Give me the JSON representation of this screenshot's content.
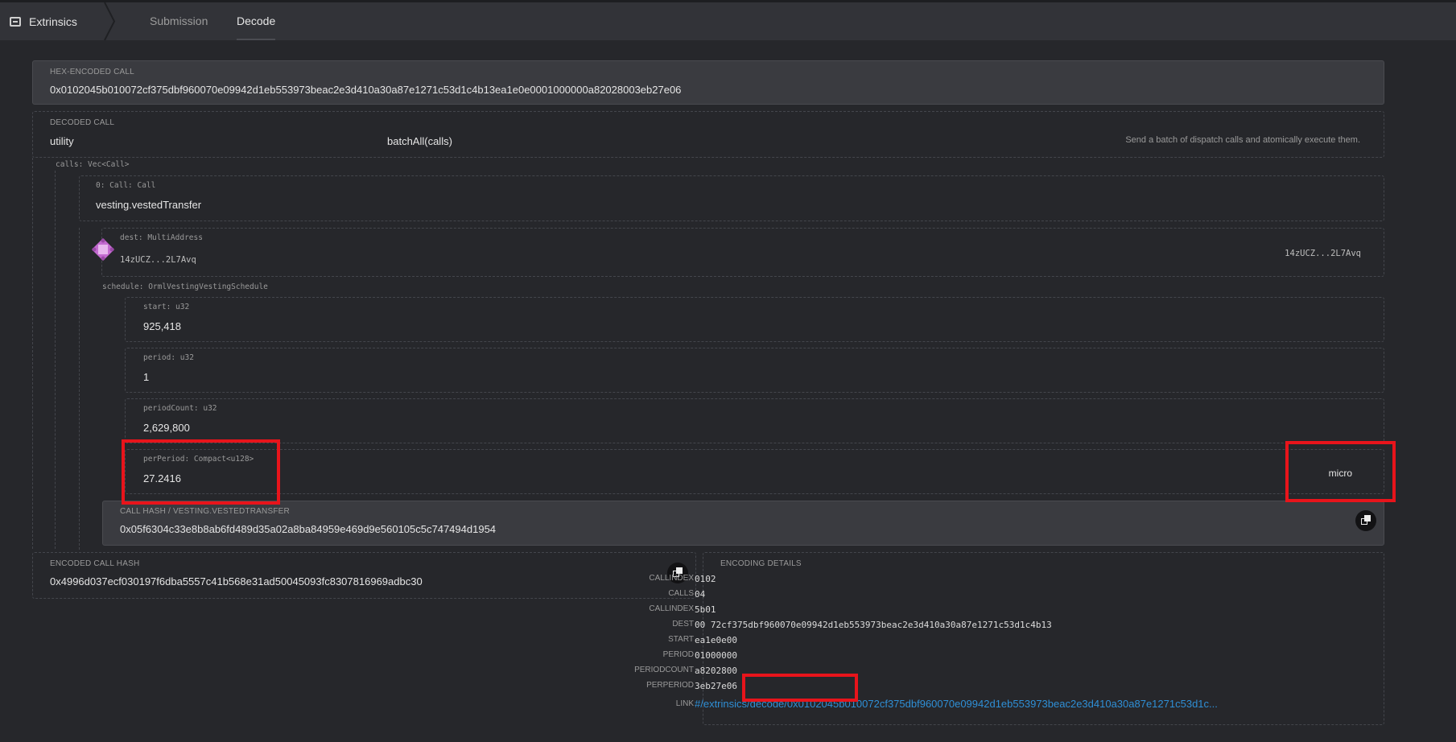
{
  "header": {
    "app_title": "Extrinsics",
    "tabs": [
      {
        "label": "Submission"
      },
      {
        "label": "Decode"
      }
    ]
  },
  "hex_call": {
    "label": "HEX-ENCODED CALL",
    "value": "0x0102045b010072cf375dbf960070e09942d1eb553973beac2e3d410a30a87e1271c53d1c4b13ea1e0e0001000000a82028003eb27e06"
  },
  "decoded_call": {
    "label": "DECODED CALL",
    "section": "utility",
    "method": "batchAll(calls)",
    "description": "Send a batch of dispatch calls and atomically execute them."
  },
  "calls": {
    "label": "calls: Vec<Call>",
    "item0_label": "0: Call: Call",
    "item0_value": "vesting.vestedTransfer",
    "dest_label": "dest: MultiAddress",
    "dest_value": "14zUCZ...2L7Avq",
    "dest_right": "14zUCZ...2L7Avq",
    "schedule_label": "schedule: OrmlVestingVestingSchedule",
    "start_label": "start: u32",
    "start_value": "925,418",
    "period_label": "period: u32",
    "period_value": "1",
    "periodcount_label": "periodCount: u32",
    "periodcount_value": "2,629,800",
    "perperiod_label": "perPeriod: Compact<u128>",
    "perperiod_value": "27.2416",
    "perperiod_unit": "micro"
  },
  "call_hash": {
    "label": "CALL HASH / VESTING.VESTEDTRANSFER",
    "value": "0x05f6304c33e8b8ab6fd489d35a02a8ba84959e469d9e560105c5c747494d1954"
  },
  "encoded_call_hash": {
    "label": "ENCODED CALL HASH",
    "value": "0x4996d037ecf030197f6dba5557c41b568e31ad50045093fc8307816969adbc30"
  },
  "encoding_details": {
    "label": "ENCODING DETAILS",
    "rows": [
      {
        "key": "CALLINDEX",
        "value": "0102"
      },
      {
        "key": "CALLS",
        "value": "04"
      },
      {
        "key": "CALLINDEX",
        "value": "5b01"
      },
      {
        "key": "DEST",
        "value": "00 72cf375dbf960070e09942d1eb553973beac2e3d410a30a87e1271c53d1c4b13"
      },
      {
        "key": "START",
        "value": "ea1e0e00"
      },
      {
        "key": "PERIOD",
        "value": "01000000"
      },
      {
        "key": "PERIODCOUNT",
        "value": "a8202800"
      },
      {
        "key": "PERPERIOD",
        "value": "3eb27e06"
      }
    ],
    "link_key": "LINK",
    "link_value": "#/extrinsics/decode/0x0102045b010072cf375dbf960070e09942d1eb553973beac2e3d410a30a87e1271c53d1c..."
  },
  "colors": {
    "highlight": "#e8141b",
    "link": "#2f8fd6",
    "identicon": "#c36bd0"
  }
}
